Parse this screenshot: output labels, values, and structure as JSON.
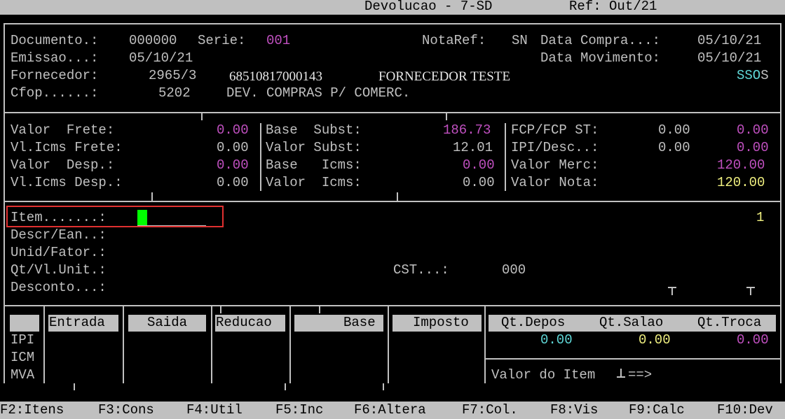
{
  "title_bar": {
    "title": "Devolucao - 7-SD",
    "ref": "Ref: Out/21"
  },
  "header": {
    "documento_label": "Documento.:",
    "documento": "000000",
    "serie_label": "Serie:",
    "serie": "001",
    "notaref_label": "NotaRef:",
    "notaref": "SN",
    "data_compra_label": "Data Compra...:",
    "data_compra": "05/10/21",
    "emissao_label": "Emissao...:",
    "emissao": "05/10/21",
    "data_mov_label": "Data Movimento:",
    "data_mov": "05/10/21",
    "fornecedor_label": "Fornecedor:",
    "fornecedor_code": "2965/3",
    "fornecedor_cnpj": "68510817000143",
    "fornecedor_name": "FORNECEDOR TESTE",
    "flags_prefix": "SSO",
    "flags_suffix": "S",
    "cfop_label": "Cfop......:",
    "cfop": "5202",
    "cfop_desc": "DEV. COMPRAS P/ COMERC."
  },
  "totals": {
    "valor_frete_label": "Valor  Frete:",
    "valor_frete": "0.00",
    "vl_icms_frete_label": "Vl.Icms Frete:",
    "vl_icms_frete": "0.00",
    "valor_desp_label": "Valor  Desp.:",
    "valor_desp": "0.00",
    "vl_icms_desp_label": "Vl.Icms Desp.:",
    "vl_icms_desp": "0.00",
    "base_subst_label": "Base  Subst:",
    "base_subst": "186.73",
    "valor_subst_label": "Valor Subst:",
    "valor_subst": "12.01",
    "base_icms_label": "Base   Icms:",
    "base_icms": "0.00",
    "valor_icms_label": "Valor  Icms:",
    "valor_icms": "0.00",
    "fcp_label": "FCP/FCP ST:",
    "fcp_1": "0.00",
    "fcp_2": "0.00",
    "ipi_label": "IPI/Desc..:",
    "ipi_1": "0.00",
    "ipi_2": "0.00",
    "valor_merc_label": "Valor Merc:",
    "valor_merc": "120.00",
    "valor_nota_label": "Valor Nota:",
    "valor_nota": "120.00"
  },
  "item": {
    "item_label": "Item.......:",
    "item_value": "",
    "item_count": "1",
    "descr_label": "Descr/Ean..:",
    "unid_label": "Unid/Fator.:",
    "qt_label": "Qt/Vl.Unit.:",
    "cst_label": "CST...:",
    "cst": "000",
    "desconto_label": "Desconto...:"
  },
  "tax_table": {
    "headers": [
      "Entrada",
      "Saida",
      "Reducao",
      "Base",
      "Imposto"
    ],
    "rows": [
      "IPI",
      "ICM",
      "MVA"
    ]
  },
  "stock": {
    "headers": [
      "Qt.Depos",
      "Qt.Salao",
      "Qt.Troca"
    ],
    "values": [
      "0.00",
      "0.00",
      "0.00"
    ],
    "valor_item_label": "Valor do Item",
    "arrow": "==>"
  },
  "function_keys": [
    "F2:Itens",
    "F3:Cons",
    "F4:Util",
    "F5:Inc",
    "F6:Altera",
    "F7:Col.",
    "F8:Vis",
    "F9:Calc",
    "F10:Dev"
  ],
  "colors": {
    "background": "#000000",
    "text": "#c0c0c0",
    "magenta": "#c050c0",
    "cyan": "#5fd7d7",
    "yellow": "#f0f080",
    "cursor": "#00ff00",
    "highlight_box": "#e03030"
  }
}
